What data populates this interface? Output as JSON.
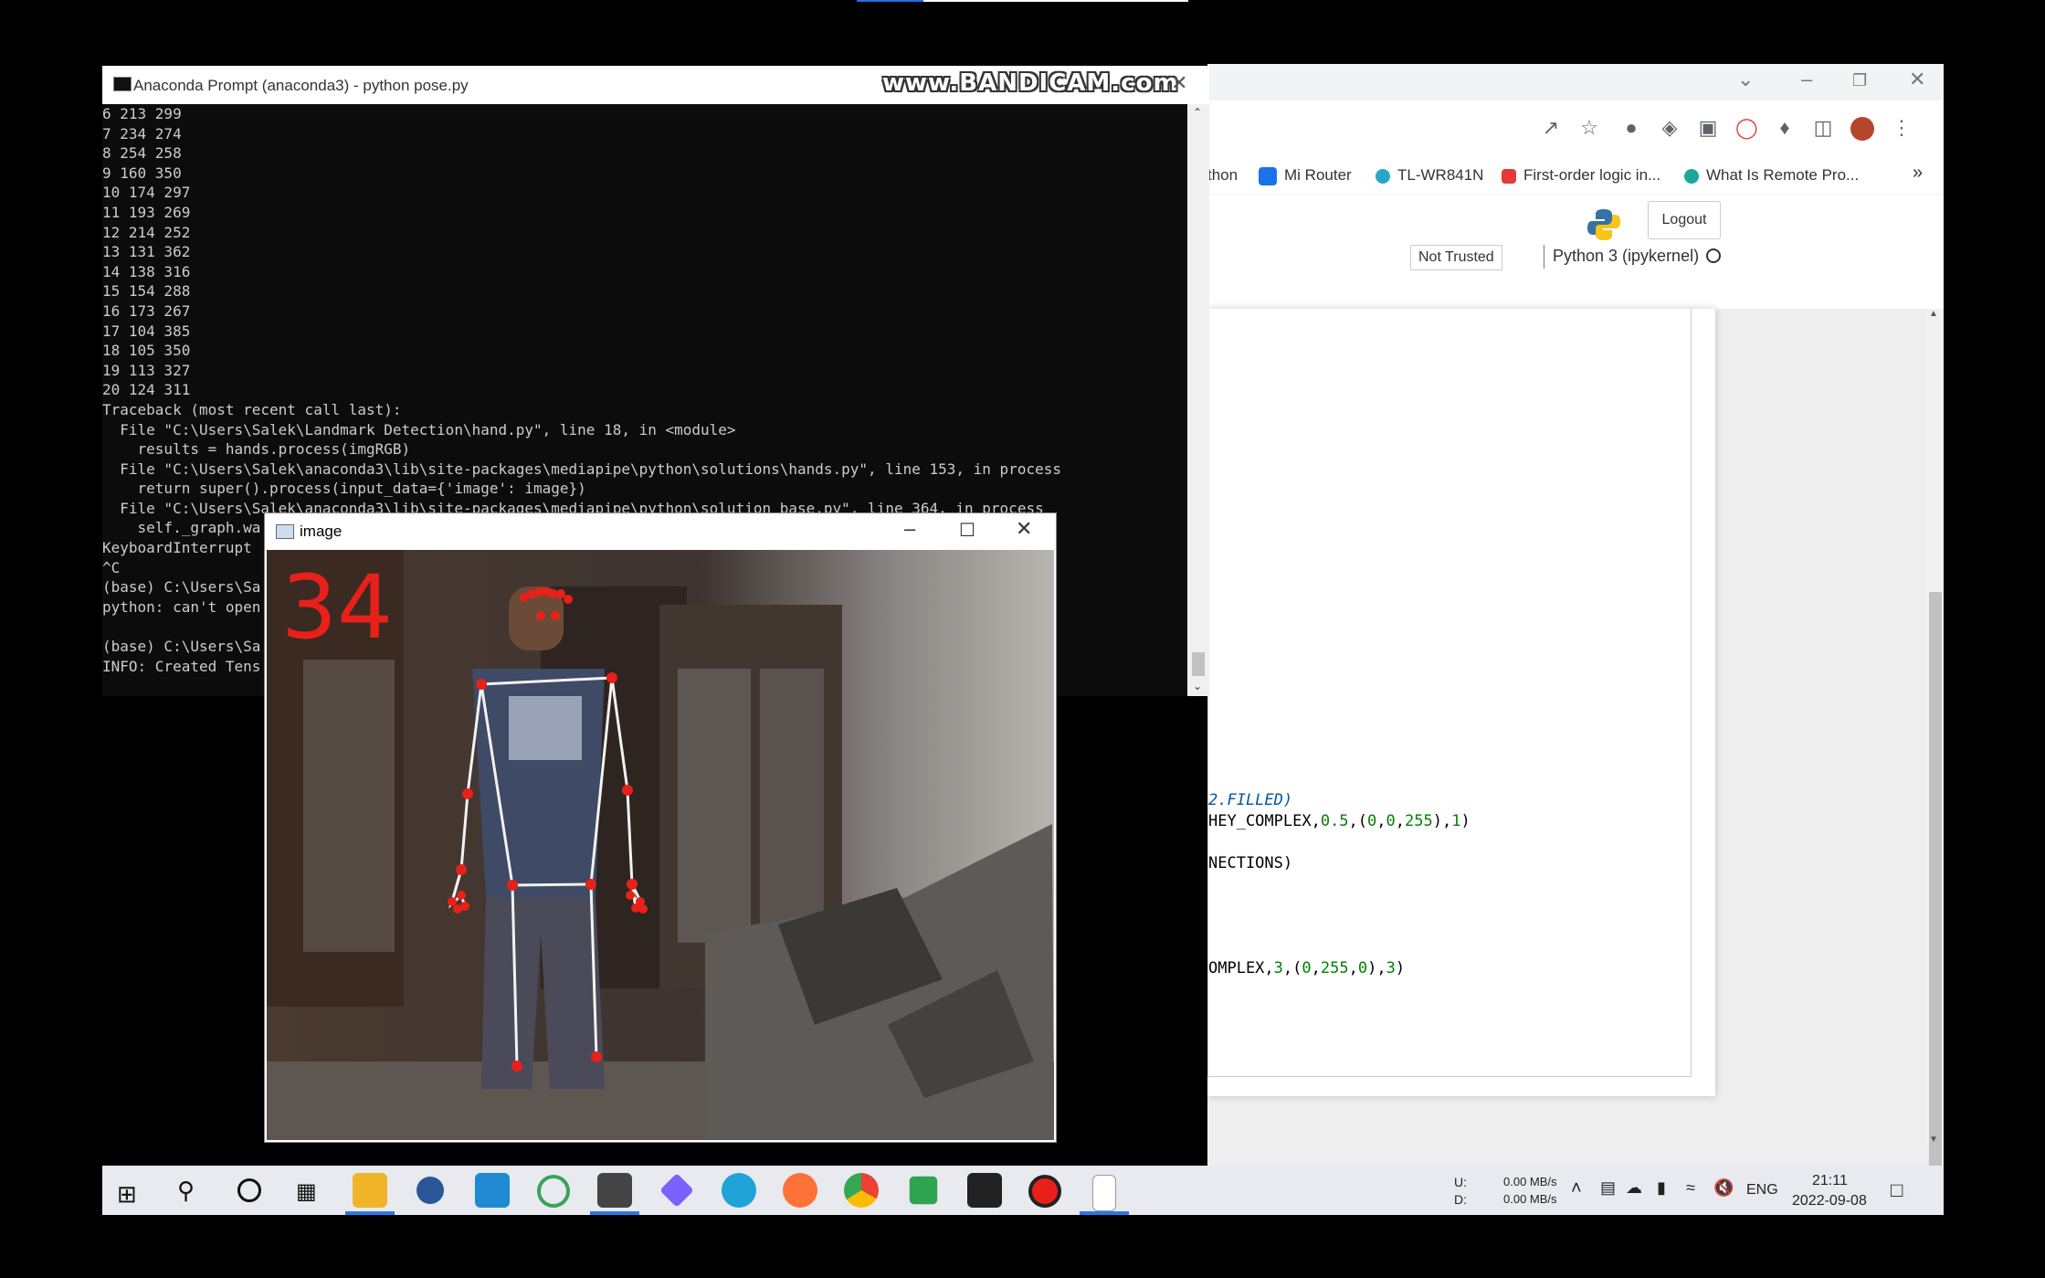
{
  "recorder": {
    "watermark": "www.BANDICAM.com"
  },
  "browser": {
    "bookmarks": [
      "thon",
      "Mi Router",
      "TL-WR841N",
      "First-order logic in...",
      "What Is Remote Pro..."
    ],
    "more_bookmarks": "»",
    "jupyter": {
      "logout_label": "Logout",
      "trust_label": "Not Trusted",
      "kernel_label": "Python 3 (ipykernel)",
      "code_lines": [
        {
          "text": "2.FILLED)"
        },
        {
          "text": "HEY_COMPLEX,0.5,(0,0,255),1)"
        },
        {
          "text": "NECTIONS)"
        },
        {
          "text": "OMPLEX,3,(0,255,0),3)"
        }
      ]
    }
  },
  "terminal": {
    "title": "Anaconda Prompt (anaconda3) - python  pose.py",
    "lines": [
      "6 213 299",
      "7 234 274",
      "8 254 258",
      "9 160 350",
      "10 174 297",
      "11 193 269",
      "12 214 252",
      "13 131 362",
      "14 138 316",
      "15 154 288",
      "16 173 267",
      "17 104 385",
      "18 105 350",
      "19 113 327",
      "20 124 311",
      "Traceback (most recent call last):",
      "  File \"C:\\Users\\Salek\\Landmark Detection\\hand.py\", line 18, in <module>",
      "    results = hands.process(imgRGB)",
      "  File \"C:\\Users\\Salek\\anaconda3\\lib\\site-packages\\mediapipe\\python\\solutions\\hands.py\", line 153, in process",
      "    return super().process(input_data={'image': image})",
      "  File \"C:\\Users\\Salek\\anaconda3\\lib\\site-packages\\mediapipe\\python\\solution_base.py\", line 364, in process",
      "    self._graph.wa",
      "KeyboardInterrupt",
      "^C",
      "(base) C:\\Users\\Sa",
      "python: can't open",
      "",
      "(base) C:\\Users\\Sa",
      "INFO: Created Tens"
    ]
  },
  "image_window": {
    "title": "image",
    "fps_counter": "34"
  },
  "taskbar": {
    "net_up_label": "U:",
    "net_down_label": "D:",
    "net_up_value": "0.00 MB/s",
    "net_down_value": "0.00 MB/s",
    "language": "ENG",
    "time": "21:11",
    "date": "2022-09-08"
  },
  "colors": {
    "accent": "#2b78e4",
    "landmark": "#e8201a",
    "fps_text": "#e8201a",
    "terminal_bg": "#0c0c0c"
  }
}
